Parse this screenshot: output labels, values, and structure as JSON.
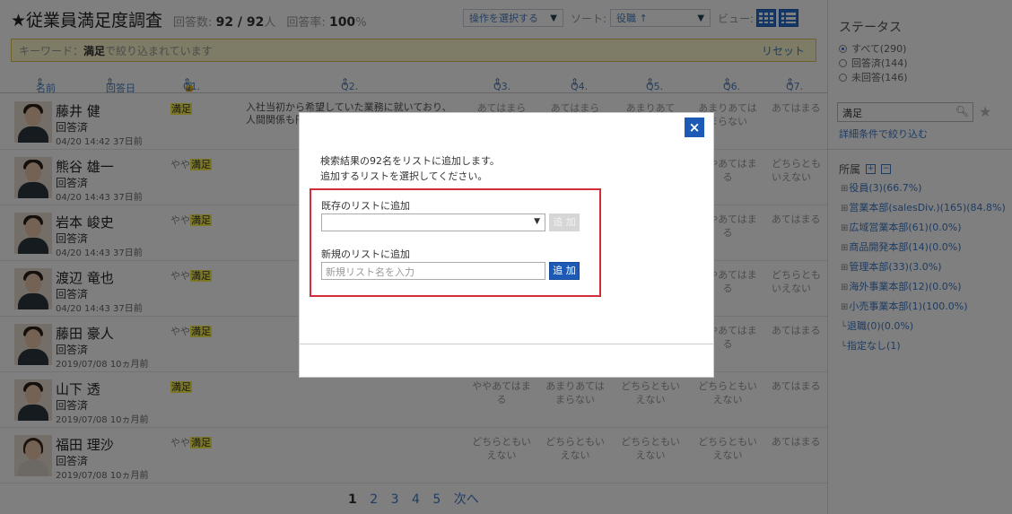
{
  "header": {
    "title": "★従業員満足度調査",
    "responses_label": "回答数:",
    "responses": "92 / 92",
    "responses_unit": "人",
    "rate_label": "回答率:",
    "rate": "100",
    "rate_unit": "%",
    "action_select": "操作を選択する",
    "sort_label": "ソート:",
    "sort_value": "役職 ↑",
    "view_label": "ビュー:"
  },
  "keyword_bar": {
    "prefix": "キーワード：",
    "keyword": "満足",
    "suffix": " で絞り込まれています",
    "reset": "リセット"
  },
  "columns": {
    "name": "名前",
    "date": "回答日",
    "q1": "Q1.",
    "q2": "Q2.",
    "q3": "Q3.",
    "q4": "Q4.",
    "q5": "Q5.",
    "q6": "Q6.",
    "q7": "Q7."
  },
  "rows": [
    {
      "name": "藤井 健",
      "status": "回答済",
      "date": "04/20 14:42 37日前",
      "q1_pre": "",
      "q1_hl": "満足",
      "q2": "入社当初から希望していた業務に就いており、人間関係も円",
      "q3": "あてはまら",
      "q4": "あてはまら",
      "q5": "あまりあて",
      "q6": "あまりあてはまらない",
      "q7": "あてはまる"
    },
    {
      "name": "熊谷 雄一",
      "status": "回答済",
      "date": "04/20 14:43 37日前",
      "q1_pre": "やや",
      "q1_hl": "満足",
      "q2": "",
      "q3": "",
      "q4": "",
      "q5": "",
      "q6": "ややあてはまる",
      "q7": "どちらともいえない"
    },
    {
      "name": "岩本 峻史",
      "status": "回答済",
      "date": "04/20 14:43 37日前",
      "q1_pre": "やや",
      "q1_hl": "満足",
      "q2": "",
      "q3": "",
      "q4": "",
      "q5": "",
      "q6": "ややあてはまる",
      "q7": "あてはまる"
    },
    {
      "name": "渡辺 竜也",
      "status": "回答済",
      "date": "04/20 14:43 37日前",
      "q1_pre": "やや",
      "q1_hl": "満足",
      "q2": "",
      "q3": "",
      "q4": "",
      "q5": "",
      "q6": "ややあてはまる",
      "q7": "どちらともいえない"
    },
    {
      "name": "藤田 豪人",
      "status": "回答済",
      "date": "2019/07/08 10ヵ月前",
      "q1_pre": "やや",
      "q1_hl": "満足",
      "q2": "",
      "q3": "",
      "q4": "",
      "q5": "",
      "q6": "ややあてはまる",
      "q7": "あてはまる"
    },
    {
      "name": "山下 透",
      "status": "回答済",
      "date": "2019/07/08 10ヵ月前",
      "q1_pre": "",
      "q1_hl": "満足",
      "q2": "",
      "q3": "ややあてはまる",
      "q4": "あまりあてはまらない",
      "q5": "どちらともいえない",
      "q6": "どちらともいえない",
      "q7": "あてはまる"
    },
    {
      "name": "福田 理沙",
      "status": "回答済",
      "date": "2019/07/08 10ヵ月前",
      "q1_pre": "やや",
      "q1_hl": "満足",
      "q2": "",
      "q3": "どちらともいえない",
      "q4": "どちらともいえない",
      "q5": "どちらともいえない",
      "q6": "どちらともいえない",
      "q7": "あてはまる"
    }
  ],
  "pager": {
    "current": "1",
    "pages": [
      "2",
      "3",
      "4",
      "5"
    ],
    "next": "次へ"
  },
  "sidebar": {
    "status_title": "ステータス",
    "radios": [
      "すべて(290)",
      "回答済(144)",
      "未回答(146)"
    ],
    "search_value": "満足",
    "advanced": "詳細条件で絞り込む",
    "org_title": "所属",
    "org_nodes": [
      "役員(3)(66.7%)",
      "営業本部(salesDiv.)(165)(84.8%)",
      "広域営業本部(61)(0.0%)",
      "商品開発本部(14)(0.0%)",
      "管理本部(33)(3.0%)",
      "海外事業本部(12)(0.0%)",
      "小売事業本部(1)(100.0%)",
      "退職(0)(0.0%)",
      "指定なし(1)"
    ]
  },
  "modal": {
    "message_line1": "検索結果の92名をリストに追加します。",
    "message_line2": "追加するリストを選択してください。",
    "existing_label": "既存のリストに追加",
    "existing_button": "追 加",
    "new_label": "新規のリストに追加",
    "new_placeholder": "新規リスト名を入力",
    "new_button": "追 加",
    "close": "×"
  },
  "colors": {
    "accent": "#1d5ab5",
    "highlight": "#f7ee4f",
    "focus_border": "#d42d3a"
  }
}
